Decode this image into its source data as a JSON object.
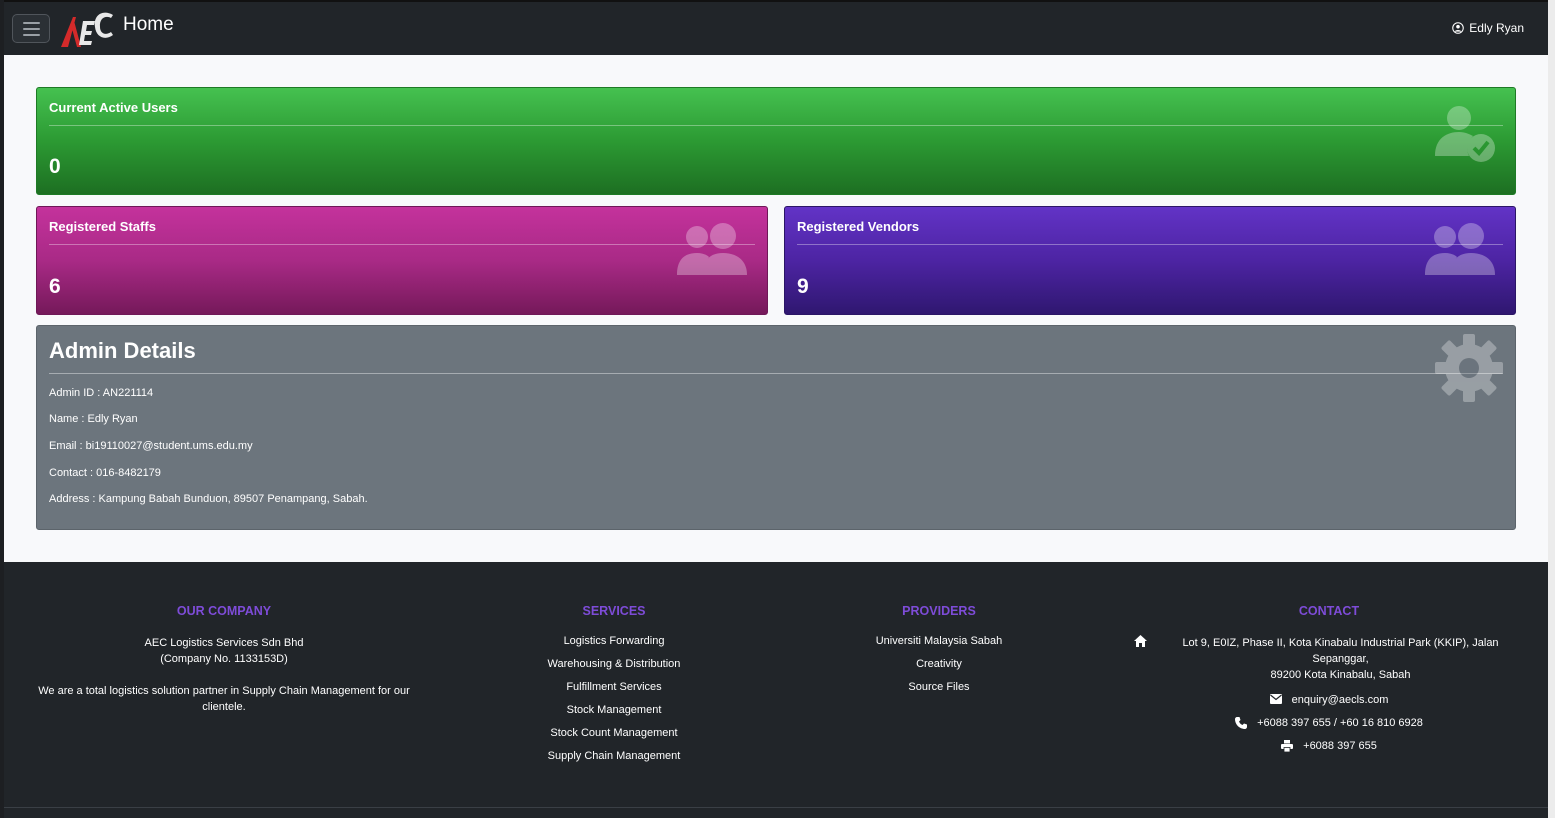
{
  "navbar": {
    "title": "Home",
    "user_name": "Edly Ryan"
  },
  "cards": {
    "active_users": {
      "label": "Current Active Users",
      "value": "0",
      "color": "#2c9a33"
    },
    "staffs": {
      "label": "Registered Staffs",
      "value": "6",
      "color": "#a92a86"
    },
    "vendors": {
      "label": "Registered Vendors",
      "value": "9",
      "color": "#4d24a3"
    }
  },
  "admin": {
    "heading": "Admin Details",
    "lines": [
      "Admin ID : AN221114",
      "Name : Edly Ryan",
      "Email : bi19110027@student.ums.edu.my",
      "Contact : 016-8482179",
      "Address : Kampung Babah Bunduon, 89507 Penampang, Sabah."
    ]
  },
  "footer": {
    "company": {
      "heading": "OUR COMPANY",
      "name": "AEC Logistics Services Sdn Bhd",
      "reg": "(Company No. 1133153D)",
      "desc_line1": "We are a total logistics solution partner in Supply Chain Management for our",
      "desc_line2": "clientele."
    },
    "services": {
      "heading": "SERVICES",
      "items": [
        "Logistics Forwarding",
        "Warehousing & Distribution",
        "Fulfillment Services",
        "Stock Management",
        "Stock Count Management",
        "Supply Chain Management"
      ]
    },
    "providers": {
      "heading": "PROVIDERS",
      "items": [
        "Universiti Malaysia Sabah",
        "Creativity",
        "Source Files"
      ]
    },
    "contact": {
      "heading": "CONTACT",
      "address_line1": "Lot 9, E0IZ, Phase II, Kota Kinabalu Industrial Park (KKIP), Jalan Sepanggar,",
      "address_line2": "89200 Kota Kinabalu, Sabah",
      "email": "enquiry@aecls.com",
      "phone": "+6088 397 655 / +60 16 810 6928",
      "fax": "+6088 397 655"
    },
    "accent_color": "#7e4cd8"
  }
}
